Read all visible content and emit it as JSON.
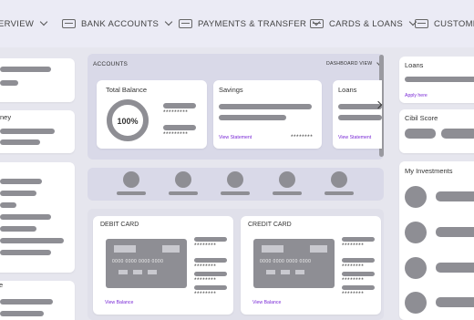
{
  "nav": {
    "items": [
      {
        "label": "ERVIEW"
      },
      {
        "label": "BANK ACCOUNTS"
      },
      {
        "label": "PAYMENTS & TRANSFER"
      },
      {
        "label": "CARDS & LOANS"
      },
      {
        "label": "CUSTOMER S"
      }
    ]
  },
  "left": {
    "money_label": "ney",
    "bottom_label": "e"
  },
  "accounts": {
    "title": "ACCOUNTS",
    "dashboard_view": "DASHBOARD VIEW",
    "total_balance": {
      "label": "Total Balance",
      "percent": "100%",
      "masked_1": "*********",
      "masked_2": "*********"
    },
    "savings": {
      "label": "Savings",
      "link": "View Statement",
      "masked": "********"
    },
    "loans": {
      "label": "Loans",
      "link": "View Statement"
    }
  },
  "debit_card": {
    "title": "DEBIT CARD",
    "number": "0000 0000 0000 0000",
    "masked": [
      "********",
      "********",
      "********",
      "********"
    ],
    "link": "View Balance"
  },
  "credit_card": {
    "title": "CREDIT CARD",
    "number": "0000 0000 0000 0000",
    "masked": [
      "********",
      "********",
      "********",
      "********"
    ],
    "link": "View Balance"
  },
  "right": {
    "loans": {
      "title": "Loans",
      "link": "Apply here"
    },
    "cibil": {
      "title": "Cibil Score"
    },
    "investments": {
      "title": "My Investments"
    }
  }
}
